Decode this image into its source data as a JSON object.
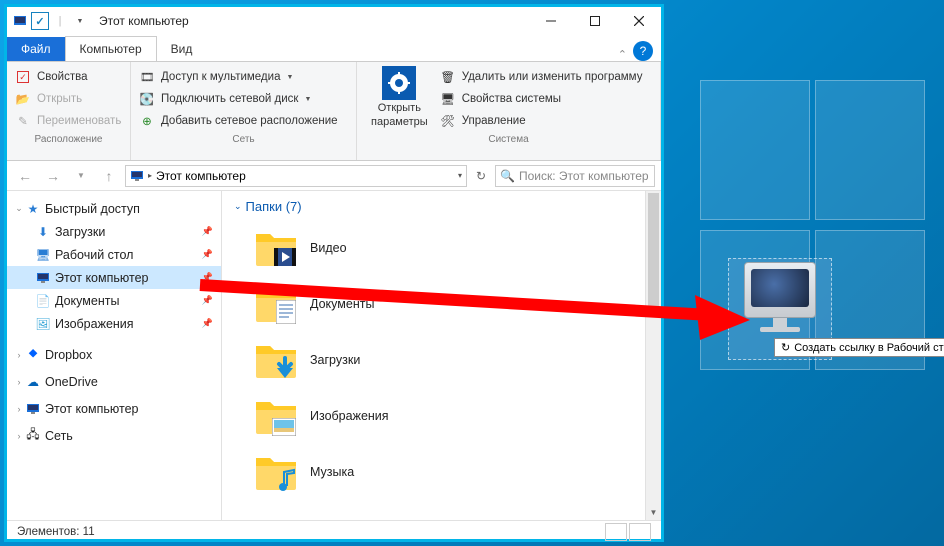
{
  "window_title": "Этот компьютер",
  "tabs": {
    "file": "Файл",
    "computer": "Компьютер",
    "view": "Вид"
  },
  "ribbon": {
    "group_location": "Расположение",
    "group_network": "Сеть",
    "group_system": "Система",
    "properties": "Свойства",
    "open": "Открыть",
    "rename": "Переименовать",
    "media_access": "Доступ к мультимедиа",
    "map_drive": "Подключить сетевой диск",
    "add_location": "Добавить сетевое расположение",
    "open_settings_l1": "Открыть",
    "open_settings_l2": "параметры",
    "uninstall": "Удалить или изменить программу",
    "sys_props": "Свойства системы",
    "manage": "Управление"
  },
  "address_bar": "Этот компьютер",
  "search_placeholder": "Поиск: Этот компьютер",
  "nav": {
    "quick_access": "Быстрый доступ",
    "downloads": "Загрузки",
    "desktop": "Рабочий стол",
    "this_pc": "Этот компьютер",
    "documents": "Документы",
    "pictures": "Изображения",
    "dropbox": "Dropbox",
    "onedrive": "OneDrive",
    "this_pc2": "Этот компьютер",
    "network": "Сеть"
  },
  "content": {
    "group_header": "Папки (7)",
    "videos": "Видео",
    "documents": "Документы",
    "downloads": "Загрузки",
    "pictures": "Изображения",
    "music": "Музыка"
  },
  "statusbar": "Элементов: 11",
  "tooltip": "Создать ссылку в Рабочий стол"
}
